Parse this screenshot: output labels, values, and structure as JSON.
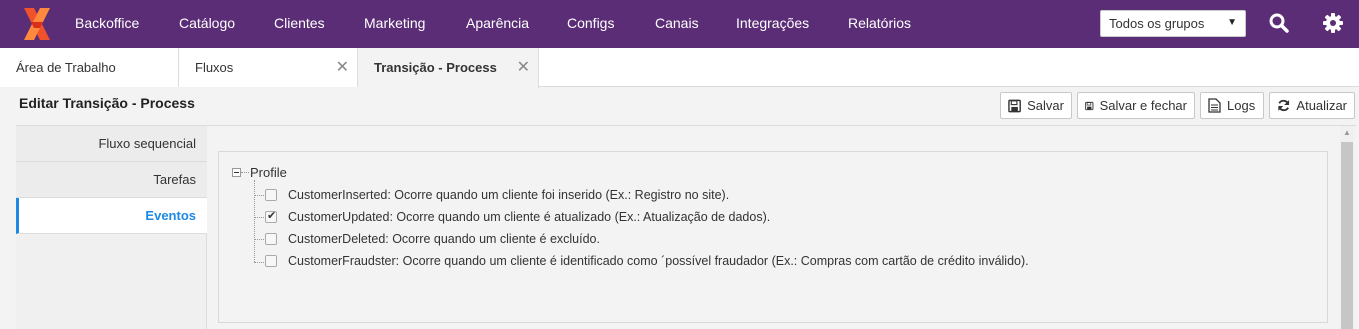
{
  "nav": {
    "items": [
      "Backoffice",
      "Catálogo",
      "Clientes",
      "Marketing",
      "Aparência",
      "Configs",
      "Canais",
      "Integrações",
      "Relatórios"
    ],
    "group_select": "Todos os grupos",
    "brand_color": "#5b2d76"
  },
  "tabs": [
    {
      "label": "Área de Trabalho"
    },
    {
      "label": "Fluxos"
    },
    {
      "label": "Transição - Process"
    }
  ],
  "page": {
    "title": "Editar Transição - Process",
    "buttons": {
      "save": "Salvar",
      "save_close": "Salvar e fechar",
      "logs": "Logs",
      "refresh": "Atualizar"
    }
  },
  "sidemenu": {
    "items": [
      "Fluxo sequencial",
      "Tarefas",
      "Eventos"
    ],
    "active": "Eventos",
    "accent": "#1e88e5"
  },
  "tree": {
    "root": "Profile",
    "events": [
      {
        "label": "CustomerInserted: Ocorre quando um cliente foi inserido (Ex.: Registro no site).",
        "checked": false
      },
      {
        "label": "CustomerUpdated: Ocorre quando um cliente é atualizado (Ex.: Atualização de dados).",
        "checked": true
      },
      {
        "label": "CustomerDeleted: Ocorre quando um cliente é excluído.",
        "checked": false
      },
      {
        "label": "CustomerFraudster: Ocorre quando um cliente é identificado como ´possível fraudador (Ex.: Compras com cartão de crédito inválido).",
        "checked": false
      }
    ]
  }
}
